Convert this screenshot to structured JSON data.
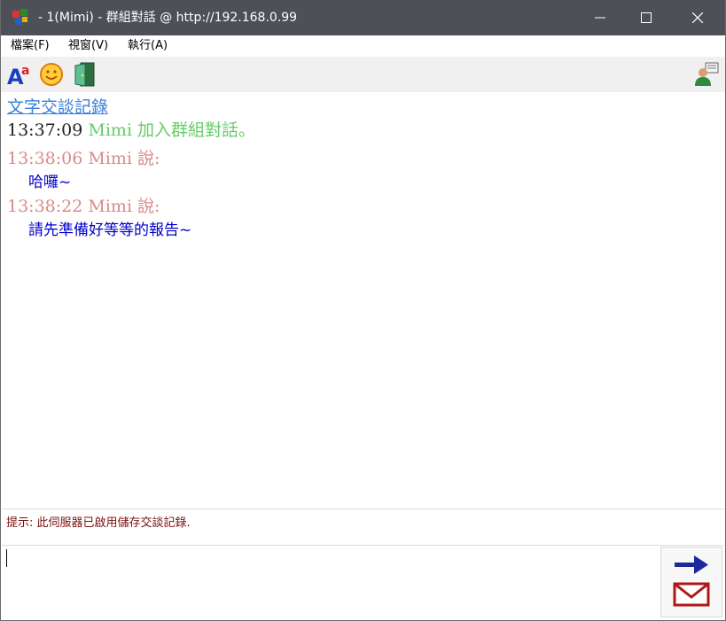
{
  "window": {
    "title": "- 1(Mimi) - 群組對話 @ http://192.168.0.99"
  },
  "menu": {
    "items": [
      "檔案(F)",
      "視窗(V)",
      "執行(A)"
    ]
  },
  "toolbar": {
    "icons": [
      "font-icon",
      "smiley-icon",
      "exit-door-icon",
      "user-list-icon"
    ]
  },
  "chat": {
    "heading": "文字交談記錄",
    "entries": [
      {
        "time": "13:37:09",
        "text": "Mimi 加入群組對話。"
      },
      {
        "time": "13:38:06",
        "text": "Mimi 說:",
        "message": "哈囉~"
      },
      {
        "time": "13:38:22",
        "text": "Mimi 說:",
        "message": "請先準備好等等的報告~"
      }
    ]
  },
  "hint": {
    "text": "提示: 此伺服器已啟用儲存交談記錄."
  },
  "input": {
    "value": ""
  },
  "colors": {
    "titlebar": "#4d5056",
    "link_blue": "#3a7fd9",
    "join_green": "#66cc66",
    "speaker_pink": "#d98a8a",
    "message_blue": "#0000cc",
    "hint_red": "#7a1010"
  }
}
